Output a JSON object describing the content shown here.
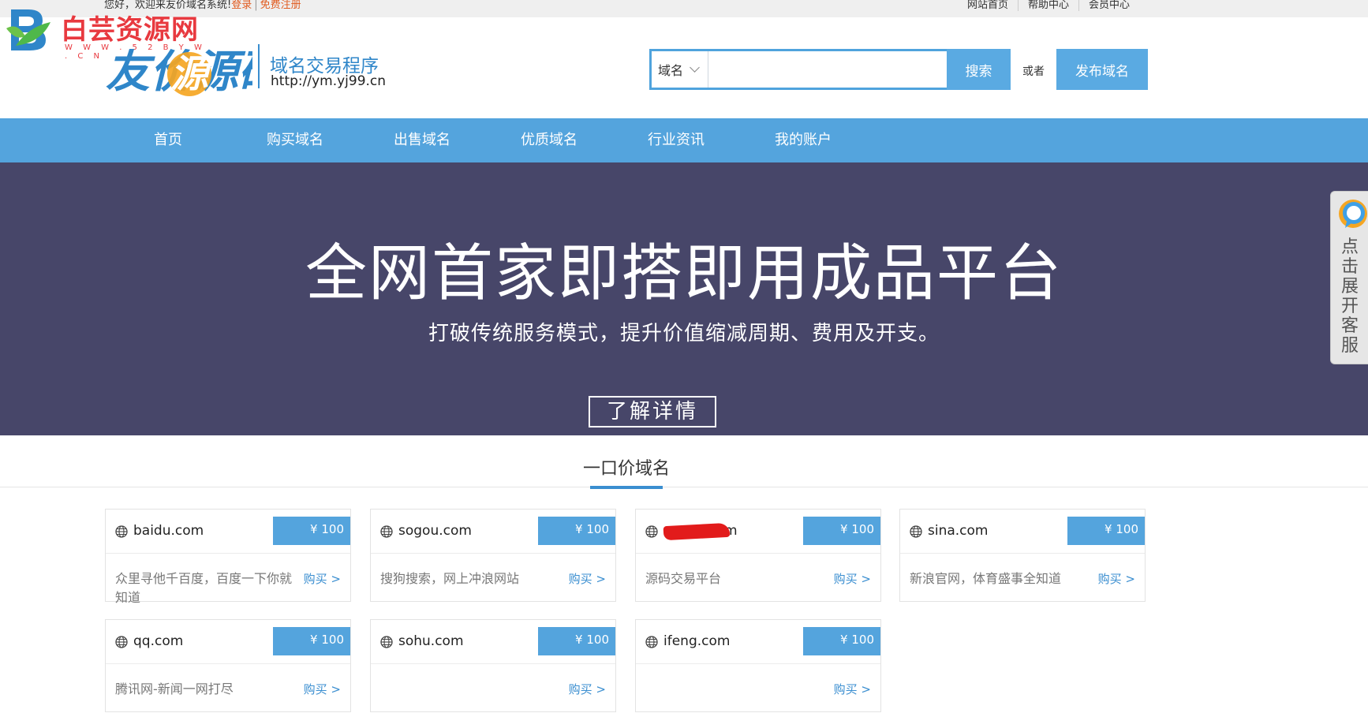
{
  "topbar": {
    "welcome": "您好，欢迎来友价域名系统!",
    "login": "登录",
    "separator": "|",
    "register": "免费注册",
    "links": [
      "网站首页",
      "帮助中心",
      "会员中心"
    ]
  },
  "watermark": {
    "text": "白芸资源网",
    "url": "W W W . 5 2 B Y W . C N",
    "logo_color": "#4fb84a"
  },
  "brand": {
    "logo_text": "友价源码",
    "title": "域名交易程序",
    "url": "http://ym.yj99.cn"
  },
  "search": {
    "type_selected": "域名",
    "input_value": "",
    "button": "搜索",
    "or": "或者",
    "publish": "发布域名"
  },
  "nav": {
    "items": [
      "首页",
      "购买域名",
      "出售域名",
      "优质域名",
      "行业资讯",
      "我的账户"
    ]
  },
  "banner": {
    "title": "全网首家即搭即用成品平台",
    "subtitle": "打破传统服务模式，提升价值缩减周期、费用及开支。",
    "button": "了解详情"
  },
  "cs_float": {
    "label": "点击展开客服"
  },
  "section": {
    "title": "一口价域名"
  },
  "domains": [
    {
      "name": "baidu.com",
      "price": "¥ 100",
      "desc": "众里寻他千百度，百度一下你就知道",
      "buy": "购买 >"
    },
    {
      "name": "sogou.com",
      "price": "¥ 100",
      "desc": "搜狗搜索，网上冲浪网站",
      "buy": "购买 >"
    },
    {
      "name": "m",
      "price": "¥ 100",
      "desc": "源码交易平台",
      "buy": "购买 >"
    },
    {
      "name": "sina.com",
      "price": "¥ 100",
      "desc": "新浪官网，体育盛事全知道",
      "buy": "购买 >"
    },
    {
      "name": "qq.com",
      "price": "¥ 100",
      "desc": "腾讯网-新闻一网打尽",
      "buy": "购买 >"
    },
    {
      "name": "sohu.com",
      "price": "¥ 100",
      "desc": "",
      "buy": "购买 >"
    },
    {
      "name": "ifeng.com",
      "price": "¥ 100",
      "desc": "",
      "buy": "购买 >"
    }
  ],
  "colors": {
    "nav_blue": "#54a4dd",
    "banner_bg": "#474669",
    "link_orange": "#e05a1e",
    "accent_blue": "#3a8ed0"
  }
}
